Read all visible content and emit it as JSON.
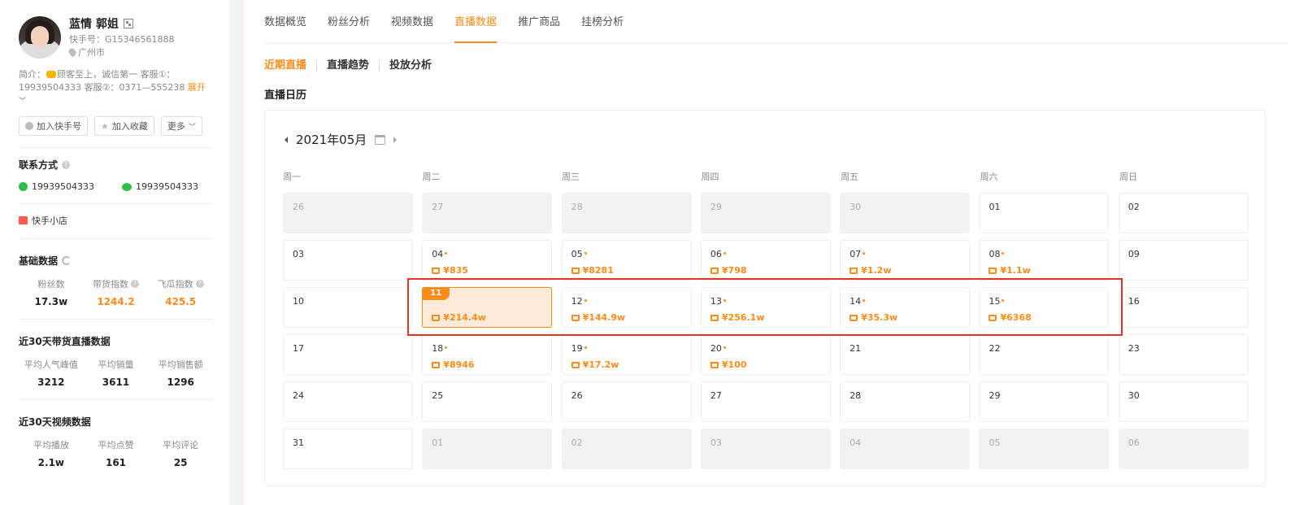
{
  "profile": {
    "name": "蓝情 郭姐",
    "kuaishou_id": "快手号：G15346561888",
    "location": "广州市",
    "intro_prefix": "简介：",
    "intro_text": "顾客至上，诚信第一 客服①：19939504333 客服②：0371—555238",
    "expand_label": "展开"
  },
  "actions": {
    "add_kuaishou": "加入快手号",
    "add_favorite": "加入收藏",
    "more": "更多"
  },
  "contact": {
    "title": "联系方式",
    "phone": "19939504333",
    "wechat": "19939504333",
    "shop": "快手小店"
  },
  "basic": {
    "title": "基础数据",
    "stats": [
      {
        "label": "粉丝数",
        "value": "17.3w"
      },
      {
        "label": "带货指数",
        "value": "1244.2"
      },
      {
        "label": "飞瓜指数",
        "value": "425.5"
      }
    ]
  },
  "live30": {
    "title": "近30天带货直播数据",
    "stats": [
      {
        "label": "平均人气峰值",
        "value": "3212"
      },
      {
        "label": "平均销量",
        "value": "3611"
      },
      {
        "label": "平均销售额",
        "value": "1296"
      }
    ]
  },
  "video30": {
    "title": "近30天视频数据",
    "stats": [
      {
        "label": "平均播放",
        "value": "2.1w"
      },
      {
        "label": "平均点赞",
        "value": "161"
      },
      {
        "label": "平均评论",
        "value": "25"
      }
    ]
  },
  "tabs": [
    "数据概览",
    "粉丝分析",
    "视频数据",
    "直播数据",
    "推广商品",
    "挂榜分析"
  ],
  "active_tab": 3,
  "subtabs": [
    "近期直播",
    "直播趋势",
    "投放分析"
  ],
  "section_title": "直播日历",
  "calendar": {
    "month_label": "2021年05月",
    "weekdays": [
      "周一",
      "周二",
      "周三",
      "周四",
      "周五",
      "周六",
      "周日"
    ],
    "selected_day": "11",
    "days": [
      {
        "d": "26",
        "other": true
      },
      {
        "d": "27",
        "other": true
      },
      {
        "d": "28",
        "other": true
      },
      {
        "d": "29",
        "other": true
      },
      {
        "d": "30",
        "other": true
      },
      {
        "d": "01"
      },
      {
        "d": "02"
      },
      {
        "d": "03"
      },
      {
        "d": "04",
        "amt": "¥835"
      },
      {
        "d": "05",
        "amt": "¥8281"
      },
      {
        "d": "06",
        "amt": "¥798"
      },
      {
        "d": "07",
        "amt": "¥1.2w"
      },
      {
        "d": "08",
        "amt": "¥1.1w"
      },
      {
        "d": "09"
      },
      {
        "d": "10"
      },
      {
        "d": "11",
        "amt": "¥214.4w",
        "selected": true
      },
      {
        "d": "12",
        "amt": "¥144.9w"
      },
      {
        "d": "13",
        "amt": "¥256.1w"
      },
      {
        "d": "14",
        "amt": "¥35.3w"
      },
      {
        "d": "15",
        "amt": "¥6368"
      },
      {
        "d": "16"
      },
      {
        "d": "17"
      },
      {
        "d": "18",
        "amt": "¥8946"
      },
      {
        "d": "19",
        "amt": "¥17.2w"
      },
      {
        "d": "20",
        "amt": "¥100"
      },
      {
        "d": "21"
      },
      {
        "d": "22"
      },
      {
        "d": "23"
      },
      {
        "d": "24"
      },
      {
        "d": "25"
      },
      {
        "d": "26"
      },
      {
        "d": "27"
      },
      {
        "d": "28"
      },
      {
        "d": "29"
      },
      {
        "d": "30"
      },
      {
        "d": "31"
      },
      {
        "d": "01",
        "other": true
      },
      {
        "d": "02",
        "other": true
      },
      {
        "d": "03",
        "other": true
      },
      {
        "d": "04",
        "other": true
      },
      {
        "d": "05",
        "other": true
      },
      {
        "d": "06",
        "other": true
      }
    ]
  },
  "colors": {
    "accent": "#ff8c1a",
    "highlight_box": "#e53326",
    "wechat": "#2bbf4a"
  }
}
